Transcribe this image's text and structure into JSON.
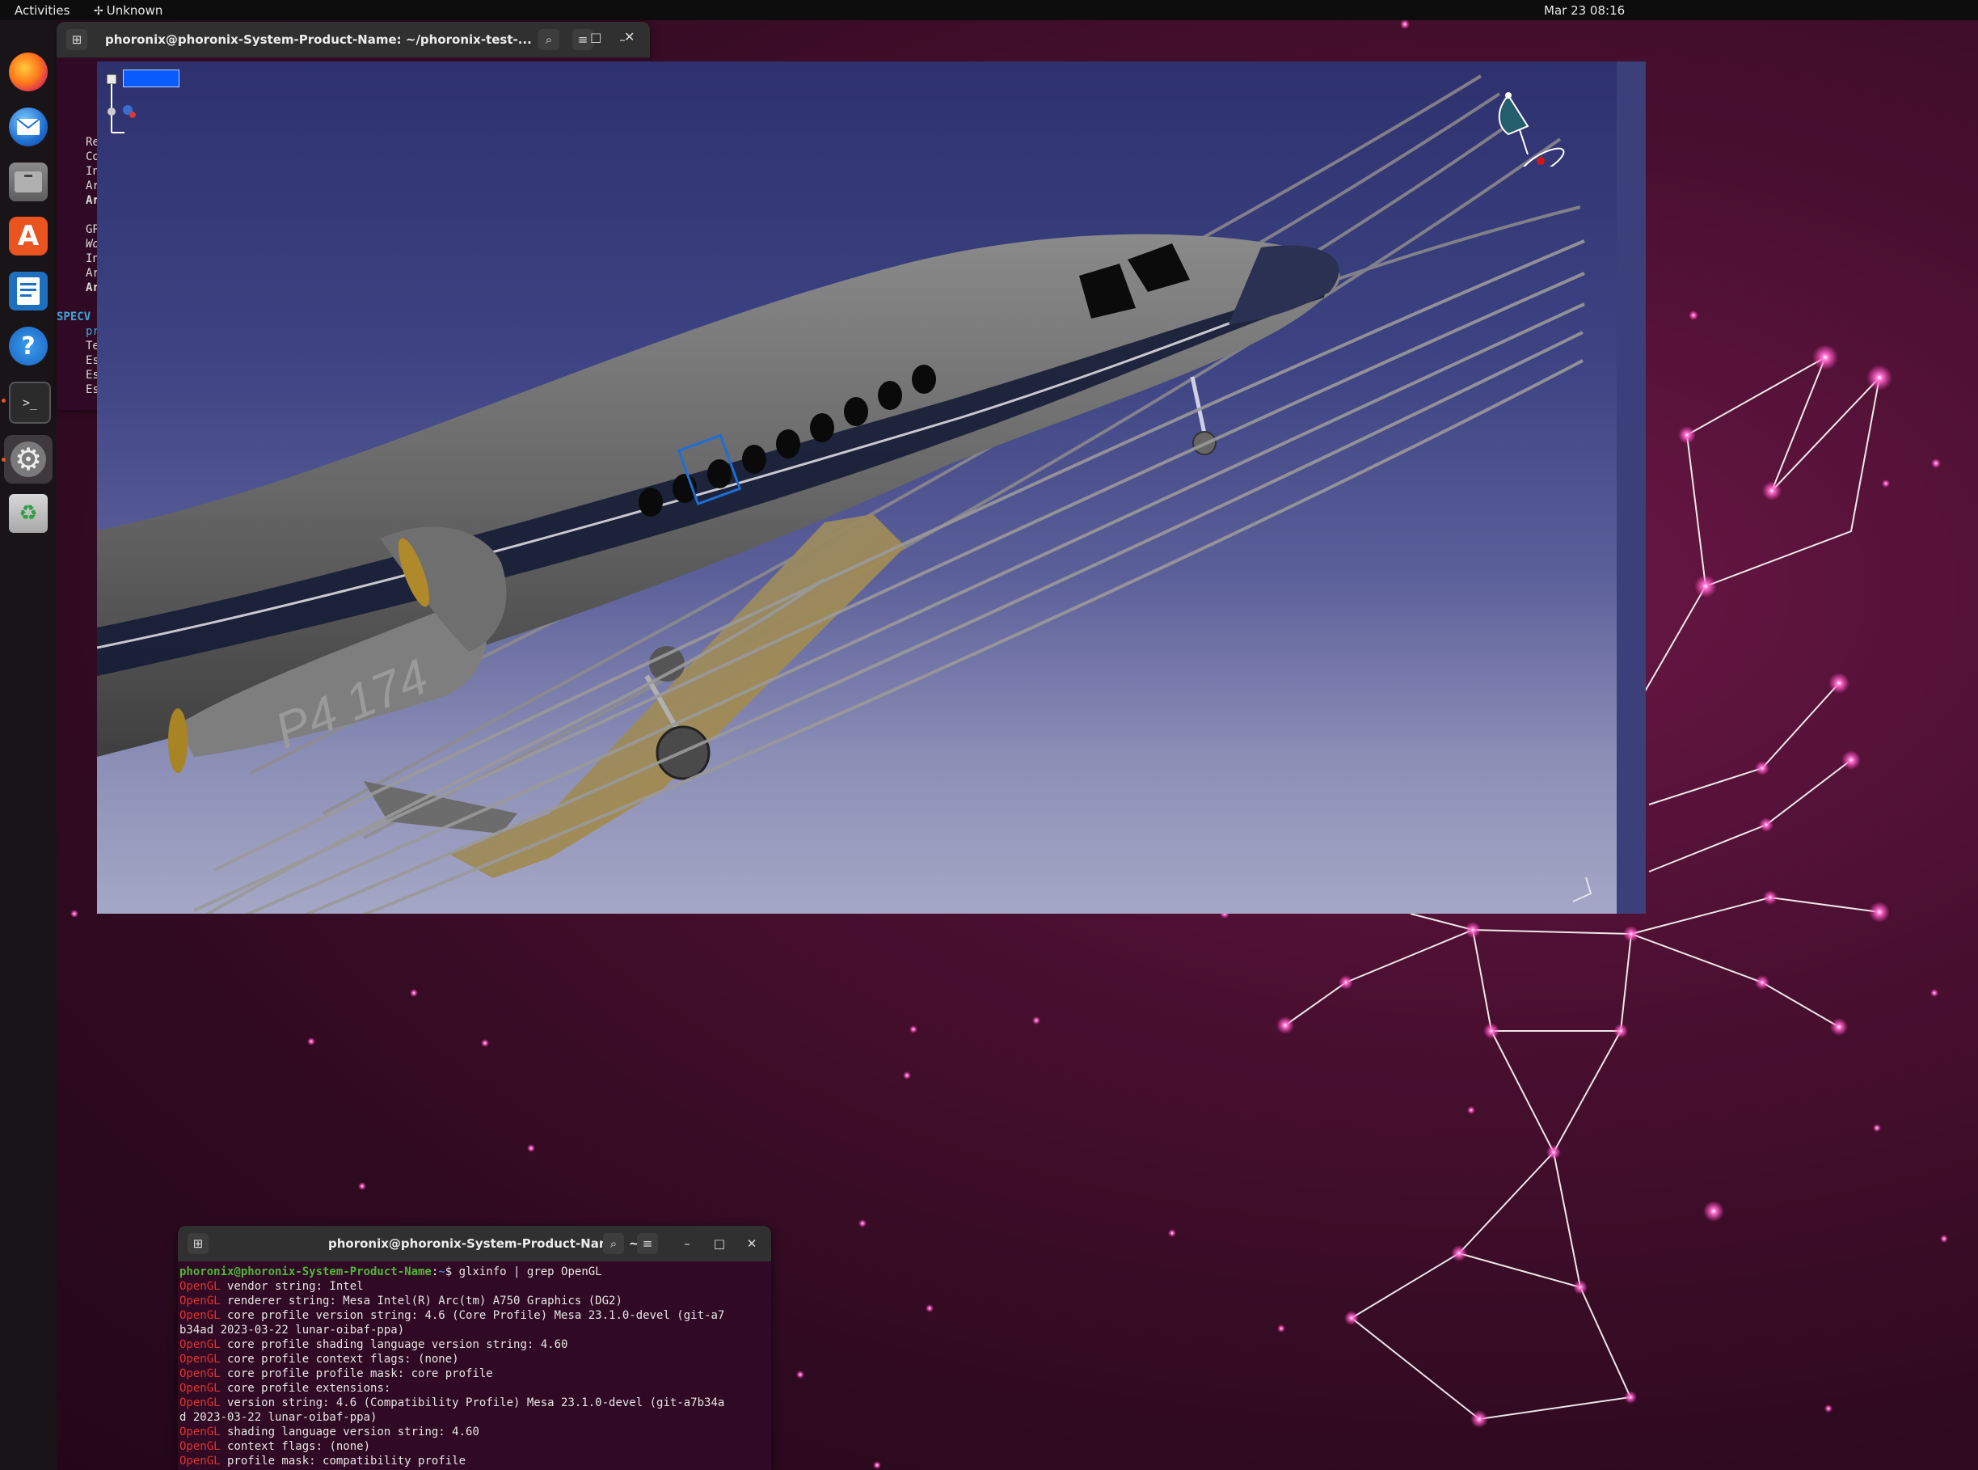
{
  "topbar": {
    "activities": "Activities",
    "app_indicator": "Unknown",
    "clock": "Mar 23  08:16"
  },
  "dock": {
    "items": [
      {
        "name": "Firefox",
        "icon": "firefox-icon"
      },
      {
        "name": "Thunderbird Mail",
        "icon": "mail-icon"
      },
      {
        "name": "Files",
        "icon": "files-icon"
      },
      {
        "name": "Ubuntu Software",
        "icon": "software-icon",
        "glyph": "A"
      },
      {
        "name": "LibreOffice Writer",
        "icon": "writer-icon"
      },
      {
        "name": "Help",
        "icon": "help-icon",
        "glyph": "?"
      },
      {
        "name": "Terminal",
        "icon": "terminal-icon",
        "glyph": ">_"
      },
      {
        "name": "Settings",
        "icon": "settings-gear-icon",
        "glyph": "⚙"
      },
      {
        "name": "Trash",
        "icon": "trash-icon",
        "glyph": "♻"
      }
    ]
  },
  "background_terminal": {
    "title": "phoronix@phoronix-System-Product-Name: ~/phoronix-test-...",
    "visible_fragments": [
      "Re",
      "Co",
      "In",
      "Ar",
      "Ar",
      "GP",
      "Wo",
      "In",
      "Ar",
      "Ar",
      "SPECV",
      "pr",
      "Te",
      "Es",
      "Es",
      "Es"
    ]
  },
  "cad_viewer": {
    "fuselage_marking": "P4 174",
    "colors": {
      "sky_top": "#2e316e",
      "sky_bottom": "#a5a7c6",
      "fuselage": "#6e6e6e",
      "selection": "#0a5cff"
    }
  },
  "foreground_terminal": {
    "title": "phoronix@phoronix-System-Product-Name: ~",
    "prompt_user": "phoronix@phoronix-System-Product-Name",
    "prompt_sep": ":",
    "prompt_path": "~",
    "prompt_symbol": "$ ",
    "command": "glxinfo | grep OpenGL",
    "keyword": "OpenGL",
    "output": [
      {
        "kw": "OpenGL",
        "text": " vendor string: Intel"
      },
      {
        "kw": "OpenGL",
        "text": " renderer string: Mesa Intel(R) Arc(tm) A750 Graphics (DG2)"
      },
      {
        "kw": "OpenGL",
        "text": " core profile version string: 4.6 (Core Profile) Mesa 23.1.0-devel (git-a7"
      },
      {
        "kw": "",
        "text": "b34ad 2023-03-22 lunar-oibaf-ppa)"
      },
      {
        "kw": "OpenGL",
        "text": " core profile shading language version string: 4.60"
      },
      {
        "kw": "OpenGL",
        "text": " core profile context flags: (none)"
      },
      {
        "kw": "OpenGL",
        "text": " core profile profile mask: core profile"
      },
      {
        "kw": "OpenGL",
        "text": " core profile extensions:"
      },
      {
        "kw": "OpenGL",
        "text": " version string: 4.6 (Compatibility Profile) Mesa 23.1.0-devel (git-a7b34a"
      },
      {
        "kw": "",
        "text": "d 2023-03-22 lunar-oibaf-ppa)"
      },
      {
        "kw": "OpenGL",
        "text": " shading language version string: 4.60"
      },
      {
        "kw": "OpenGL",
        "text": " context flags: (none)"
      },
      {
        "kw": "OpenGL",
        "text": " profile mask: compatibility profile"
      }
    ]
  }
}
